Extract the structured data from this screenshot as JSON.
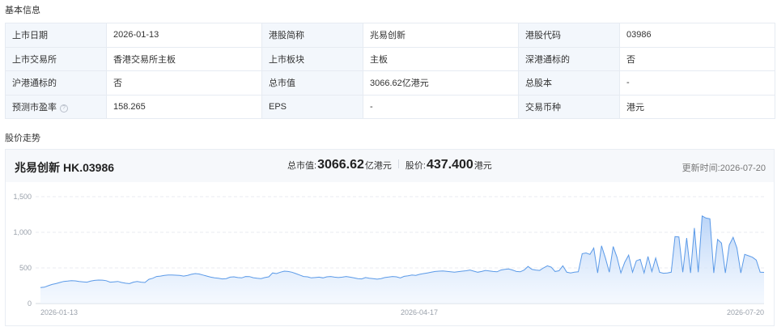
{
  "sections": {
    "basic_info_title": "基本信息",
    "trend_title": "股价走势"
  },
  "info_table": {
    "rows": [
      [
        {
          "label": "上市日期",
          "value": "2026-01-13"
        },
        {
          "label": "港股简称",
          "value": "兆易创新"
        },
        {
          "label": "港股代码",
          "value": "03986"
        }
      ],
      [
        {
          "label": "上市交易所",
          "value": "香港交易所主板"
        },
        {
          "label": "上市板块",
          "value": "主板"
        },
        {
          "label": "深港通标的",
          "value": "否"
        }
      ],
      [
        {
          "label": "沪港通标的",
          "value": "否"
        },
        {
          "label": "总市值",
          "value": "3066.62亿港元"
        },
        {
          "label": "总股本",
          "value": "-"
        }
      ],
      [
        {
          "label": "预测市盈率",
          "value": "158.265"
        },
        {
          "label": "EPS",
          "value": "-"
        },
        {
          "label": "交易币种",
          "value": "港元"
        }
      ]
    ],
    "help_icon_glyph": "?"
  },
  "chart_header": {
    "stock_name": "兆易创新",
    "stock_code": "HK.03986",
    "market_cap_label": "总市值:",
    "market_cap_value": "3066.62",
    "market_cap_unit": "亿港元",
    "price_label": "股价:",
    "price_value": "437.400",
    "price_unit": "港元",
    "update_label": "更新时间:",
    "update_date": "2026-07-20"
  },
  "colors": {
    "line": "#5b9ae8",
    "area_top": "#b3d0f7",
    "area_bottom": "#eef5fe",
    "grid": "#e8ebf0"
  },
  "chart_data": {
    "type": "area",
    "title": "",
    "xlabel": "",
    "ylabel": "",
    "ylim": [
      0,
      1500
    ],
    "yticks": [
      0,
      500,
      1000,
      1500
    ],
    "ytick_labels": [
      "0",
      "500",
      "1,000",
      "1,500"
    ],
    "x_start": "2026-01-13",
    "x_end": "2026-07-20",
    "xtick_labels": [
      "2026-01-13",
      "2026-04-17",
      "2026-07-20"
    ],
    "grid": true,
    "series": [
      {
        "values": [
          225,
          230,
          250,
          268,
          280,
          295,
          310,
          315,
          320,
          318,
          310,
          305,
          300,
          315,
          325,
          330,
          328,
          320,
          300,
          305,
          310,
          295,
          285,
          280,
          300,
          310,
          300,
          295,
          340,
          355,
          380,
          385,
          395,
          400,
          400,
          398,
          395,
          385,
          395,
          410,
          420,
          415,
          400,
          385,
          370,
          360,
          355,
          345,
          350,
          370,
          375,
          365,
          360,
          380,
          378,
          362,
          355,
          350,
          365,
          375,
          430,
          420,
          440,
          455,
          450,
          440,
          420,
          400,
          380,
          375,
          360,
          365,
          370,
          360,
          375,
          380,
          370,
          365,
          370,
          380,
          370,
          360,
          350,
          345,
          365,
          355,
          350,
          342,
          350,
          365,
          372,
          380,
          375,
          360,
          382,
          390,
          400,
          395,
          410,
          420,
          430,
          440,
          450,
          455,
          458,
          452,
          445,
          440,
          448,
          455,
          460,
          470,
          455,
          440,
          450,
          465,
          458,
          450,
          445,
          470,
          480,
          485,
          470,
          450,
          445,
          470,
          520,
          480,
          470,
          465,
          500,
          530,
          510,
          450,
          460,
          530,
          440,
          430,
          440,
          445,
          700,
          710,
          690,
          780,
          430,
          810,
          640,
          440,
          800,
          650,
          430,
          580,
          680,
          440,
          600,
          620,
          430,
          660,
          450,
          640,
          440,
          425,
          430,
          440,
          940,
          935,
          440,
          920,
          430,
          1060,
          440,
          1230,
          1200,
          1190,
          430,
          900,
          850,
          430,
          820,
          930,
          780,
          430,
          690,
          670,
          650,
          610,
          440,
          437
        ]
      }
    ]
  }
}
